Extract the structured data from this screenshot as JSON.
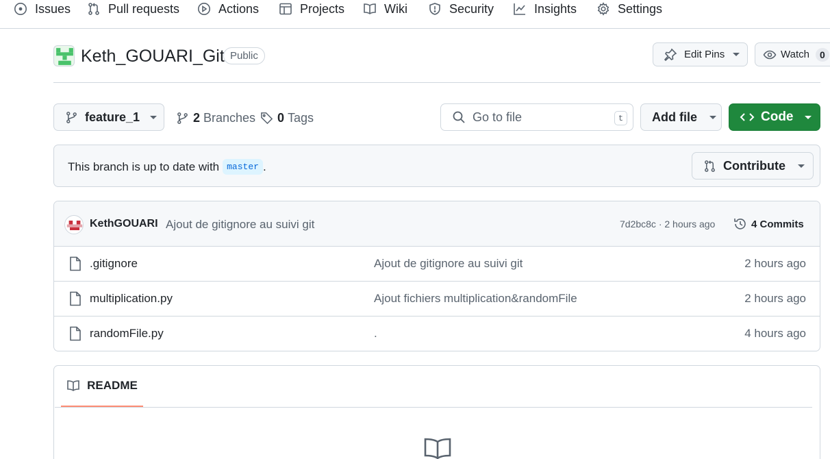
{
  "nav": {
    "items": [
      {
        "label": "Issues",
        "icon": "issue-icon"
      },
      {
        "label": "Pull requests",
        "icon": "pull-request-icon"
      },
      {
        "label": "Actions",
        "icon": "play-icon"
      },
      {
        "label": "Projects",
        "icon": "table-icon"
      },
      {
        "label": "Wiki",
        "icon": "book-icon"
      },
      {
        "label": "Security",
        "icon": "shield-icon"
      },
      {
        "label": "Insights",
        "icon": "graph-icon"
      },
      {
        "label": "Settings",
        "icon": "gear-icon"
      }
    ]
  },
  "repo": {
    "name": "Keth_GOUARI_Git",
    "visibility": "Public",
    "edit_pins_label": "Edit Pins",
    "watch_label": "Watch",
    "watch_count": "0"
  },
  "branch_bar": {
    "current_branch": "feature_1",
    "branches_count": "2",
    "branches_label": "Branches",
    "tags_count": "0",
    "tags_label": "Tags",
    "search_placeholder": "Go to file",
    "search_shortcut": "t",
    "add_file_label": "Add file",
    "code_label": "Code"
  },
  "banner": {
    "text": "This branch is up to date with",
    "base_branch": "master",
    "suffix": ".",
    "contribute_label": "Contribute"
  },
  "latest_commit": {
    "author": "KethGOUARI",
    "message": "Ajout de gitignore au suivi git",
    "sha_time": "7d2bc8c · 2 hours ago",
    "commits_label": "4 Commits"
  },
  "files": [
    {
      "name": ".gitignore",
      "message": "Ajout de gitignore au suivi git",
      "time": "2 hours ago"
    },
    {
      "name": "multiplication.py",
      "message": "Ajout fichiers multiplication&randomFile",
      "time": "2 hours ago"
    },
    {
      "name": "randomFile.py",
      "message": ".",
      "time": "4 hours ago"
    }
  ],
  "readme": {
    "tab_label": "README"
  },
  "colors": {
    "accent_green": "#1f883d",
    "tab_underline": "#fd8c73",
    "muted_text": "#59636e"
  }
}
